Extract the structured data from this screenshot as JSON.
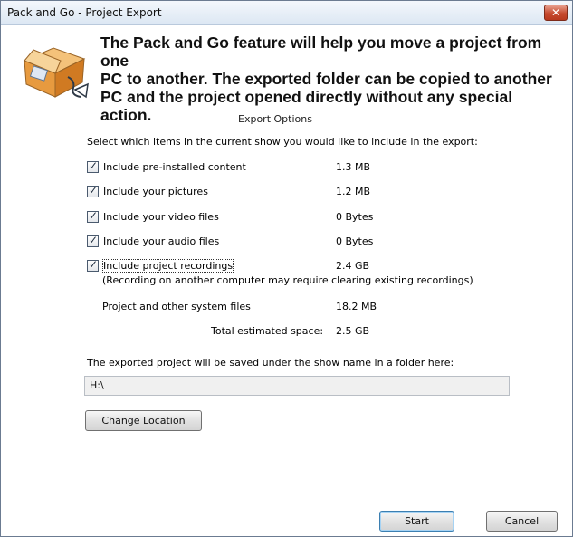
{
  "window": {
    "title": "Pack and Go - Project Export",
    "close_label": "✕"
  },
  "intro": {
    "line1": "The Pack and Go feature will help you move a project from one",
    "line2": "PC to another.  The exported folder can be copied to another",
    "line3": "PC and the project opened directly without any special action."
  },
  "export_options": {
    "group_title": "Export Options",
    "select_prompt": "Select which items in the current show you would like to include in the export:",
    "options": [
      {
        "label": "Include pre-installed content",
        "size": "1.3 MB",
        "checked": true
      },
      {
        "label": "Include your pictures",
        "size": "1.2 MB",
        "checked": true
      },
      {
        "label": "Include your video files",
        "size": "0 Bytes",
        "checked": true
      },
      {
        "label": "Include your audio files",
        "size": "0 Bytes",
        "checked": true
      },
      {
        "label": "Include project recordings",
        "size": "2.4 GB",
        "checked": true
      }
    ],
    "recordings_note": "(Recording on another computer may require clearing existing recordings)",
    "system_files_label": "Project and other system files",
    "system_files_size": "18.2 MB",
    "total_label": "Total estimated space:",
    "total_size": "2.5 GB"
  },
  "location": {
    "saved_text": "The exported project will be saved under the show name in a folder here:",
    "path": "H:\\",
    "change_button": "Change Location"
  },
  "footer": {
    "start_button": "Start",
    "cancel_button": "Cancel"
  },
  "colors": {
    "titlebar": "#dce7f3",
    "close_button": "#c64a2f",
    "default_button_border": "#3c7fb1"
  },
  "icons": {
    "app_icon": "package-box-icon",
    "check": "checkmark-icon"
  }
}
